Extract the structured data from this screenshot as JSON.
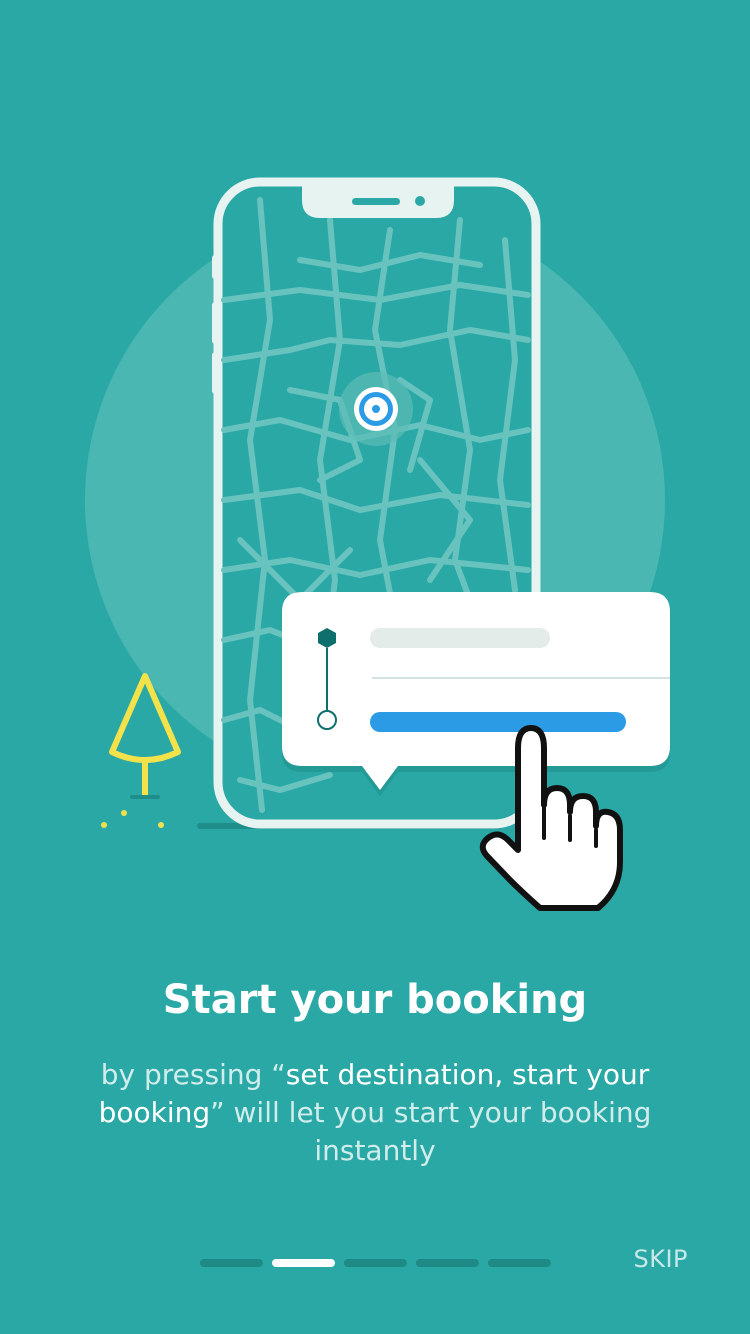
{
  "onboarding": {
    "title": "Start your booking",
    "body_prefix": "by pressing “",
    "body_emphasis": "set destination, start your booking",
    "body_suffix": "” will let you start your booking instantly",
    "skip_label": "SKIP",
    "page_indicator": {
      "total": 5,
      "current": 2
    }
  },
  "colors": {
    "background": "#2aa8a5",
    "accent_blue": "#2b9be6",
    "tree_yellow": "#f4e24a",
    "active_dot": "#ffffff",
    "inactive_dot": "#1f8986"
  }
}
